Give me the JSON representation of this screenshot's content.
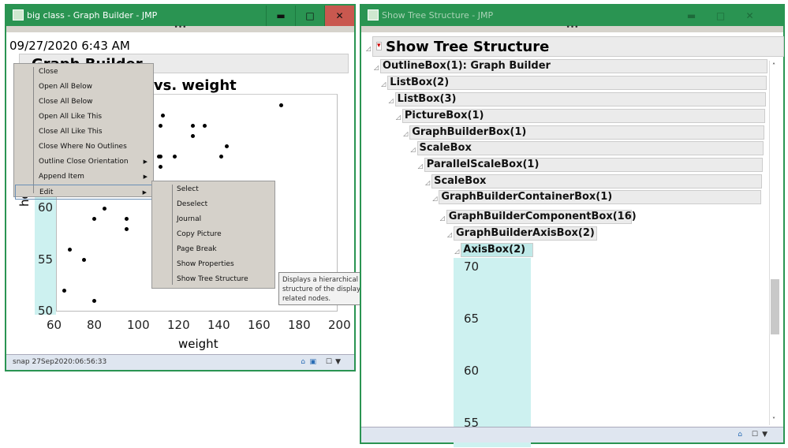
{
  "left_window": {
    "title": "big class - Graph Builder - JMP",
    "timestamp": "09/27/2020 6:43 AM",
    "outline_title": "Graph Builder",
    "graph_title": "height vs. weight",
    "graph_title_visible": "t vs. weight",
    "xlabel": "weight",
    "ylabel": "height",
    "ylabel_visible": "heig",
    "status": "snap 27Sep2020:06:56:33",
    "dots": "•••"
  },
  "context_menu": {
    "items": [
      "Close",
      "Open All Below",
      "Close All Below",
      "Open All Like This",
      "Close All Like This",
      "Close Where No Outlines",
      "Outline Close Orientation",
      "Append Item",
      "Edit"
    ],
    "submenu_flags": [
      false,
      false,
      false,
      false,
      false,
      false,
      true,
      true,
      true
    ],
    "highlighted": "Edit"
  },
  "edit_submenu": {
    "items": [
      "Select",
      "Deselect",
      "Journal",
      "Copy Picture",
      "Page Break",
      "Show Properties",
      "Show Tree Structure"
    ]
  },
  "tooltip": "Displays a hierarchical tree structure of the display box and its related nodes.",
  "chart_data": {
    "type": "scatter",
    "title": "height vs. weight",
    "xlabel": "weight",
    "ylabel": "height",
    "xlim": [
      60,
      200
    ],
    "ylim": [
      50,
      71
    ],
    "x_ticks": [
      "60",
      "80",
      "100",
      "120",
      "140",
      "160",
      "180",
      "200"
    ],
    "y_ticks": [
      "50",
      "55",
      "60"
    ],
    "points": [
      [
        172,
        70
      ],
      [
        113,
        69
      ],
      [
        112,
        68
      ],
      [
        128,
        68
      ],
      [
        134,
        68
      ],
      [
        128,
        67
      ],
      [
        145,
        66
      ],
      [
        111,
        65
      ],
      [
        112,
        65
      ],
      [
        119,
        65
      ],
      [
        142,
        65
      ],
      [
        112,
        64
      ],
      [
        84,
        60
      ],
      [
        79,
        59
      ],
      [
        95,
        59
      ],
      [
        95,
        58
      ],
      [
        67,
        56
      ],
      [
        74,
        55
      ],
      [
        64,
        52
      ],
      [
        79,
        51
      ]
    ]
  },
  "right_window": {
    "title": "Show Tree Structure - JMP",
    "heading": "Show Tree Structure",
    "dots": "•••",
    "nodes": [
      "OutlineBox(1): Graph Builder",
      "ListBox(2)",
      "ListBox(3)",
      "PictureBox(1)",
      "GraphBuilderBox(1)",
      "ScaleBox",
      "ParallelScaleBox(1)",
      "ScaleBox",
      "GraphBuilderContainerBox(1)",
      "GraphBuilderComponentBox(16)",
      "GraphBuilderAxisBox(2)",
      "AxisBox(2)"
    ],
    "axis_ticks": [
      "70",
      "65",
      "60",
      "55"
    ]
  },
  "colors": {
    "titlebar": "#2a9452",
    "close": "#c9584f",
    "axis_highlight": "#cdf1f0"
  }
}
